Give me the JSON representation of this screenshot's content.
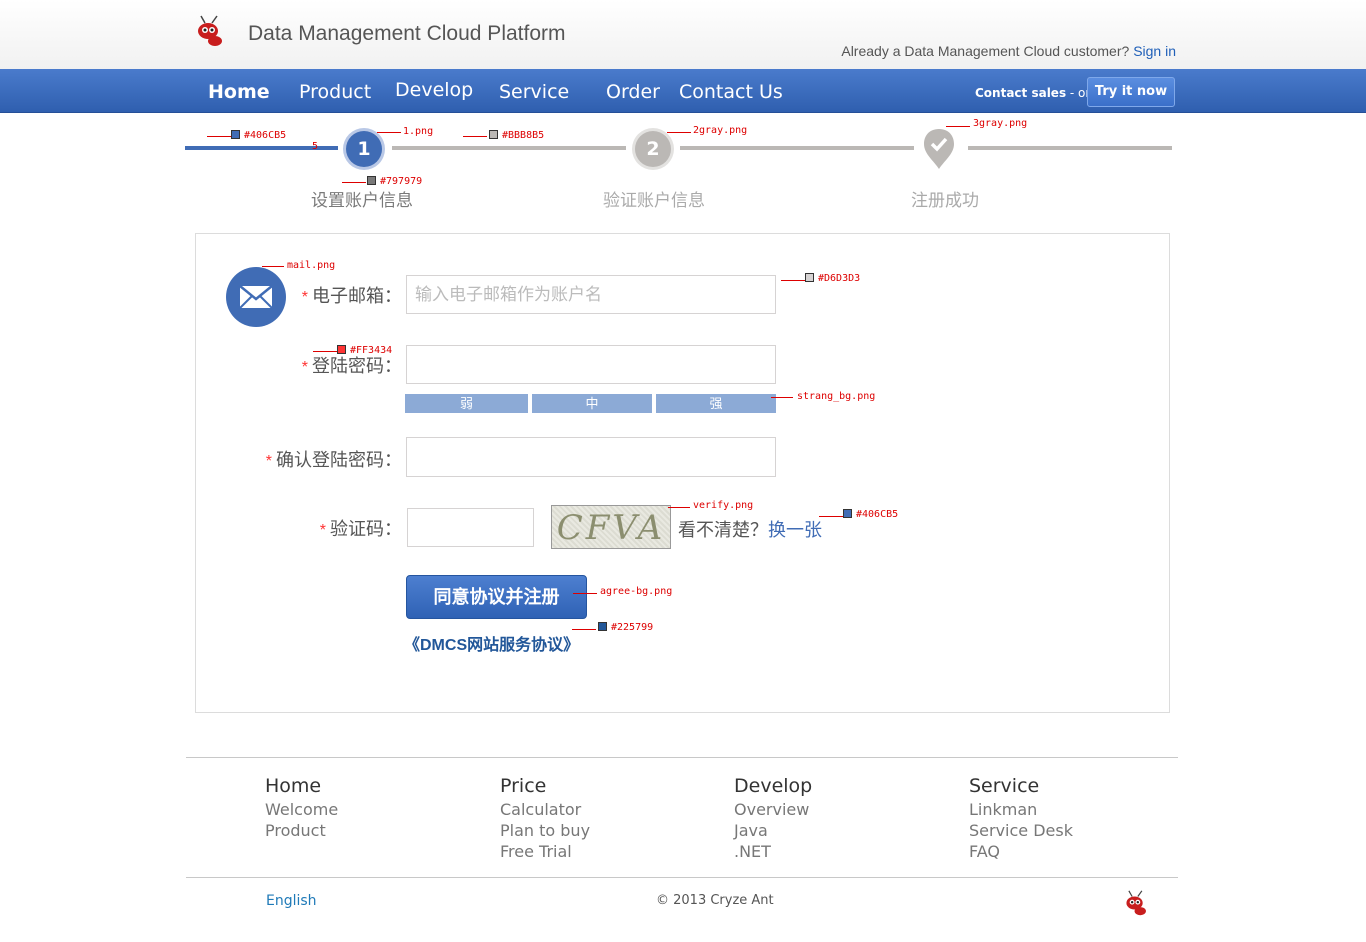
{
  "header": {
    "site_title": "Data Management Cloud Platform",
    "customer_prompt": "Already a Data Management Cloud customer?",
    "signin_label": "Sign in"
  },
  "nav": {
    "items": [
      "Home",
      "Product",
      "Develop",
      "Service",
      "Order",
      "Contact Us"
    ],
    "contact_sales": "Contact sales",
    "or_text": " - or - ",
    "try_label": "Try it now"
  },
  "steps": {
    "items": [
      {
        "number": "1",
        "label": "设置账户信息"
      },
      {
        "number": "2",
        "label": "验证账户信息"
      },
      {
        "number": "",
        "label": "注册成功"
      }
    ]
  },
  "annotations": {
    "line_color": "#406CB5",
    "step1_icon": "1.png",
    "inactive_line": "#BBB8B5",
    "step2_icon": "2gray.png",
    "step3_icon": "3gray.png",
    "label_color": "#797979",
    "mail_icon": "mail.png",
    "input_border": "#D6D3D3",
    "required_color": "#FF3434",
    "strength_bg": "strang_bg.png",
    "verify_img": "verify.png",
    "link_color": "#406CB5",
    "agree_bg": "agree-bg.png",
    "protocol_color": "#225799",
    "five": "5"
  },
  "form": {
    "required_mark": "*",
    "email_label": "电子邮箱：",
    "email_placeholder": "输入电子邮箱作为账户名",
    "password_label": "登陆密码：",
    "strength": [
      "弱",
      "中",
      "强"
    ],
    "confirm_label": "确认登陆密码：",
    "captcha_label": "验证码：",
    "captcha_text": "CFVA",
    "unclear_text": "看不清楚？",
    "change_text": "换一张",
    "agree_label": "同意协议并注册",
    "protocol_text": "《DMCS网站服务协议》"
  },
  "footer": {
    "columns": [
      {
        "title": "Home",
        "links": [
          "Welcome",
          "Product"
        ]
      },
      {
        "title": "Price",
        "links": [
          "Calculator",
          "Plan to buy",
          "Free Trial"
        ]
      },
      {
        "title": "Develop",
        "links": [
          "Overview",
          "Java",
          ".NET"
        ]
      },
      {
        "title": "Service",
        "links": [
          "Linkman",
          "Service Desk",
          "FAQ"
        ]
      }
    ],
    "language": "English",
    "copyright": "© 2013 Cryze Ant"
  },
  "colors": {
    "brand_blue": "#406CB5",
    "inactive_gray": "#BBB8B5",
    "required_red": "#FF3434",
    "link_dark": "#225799"
  }
}
